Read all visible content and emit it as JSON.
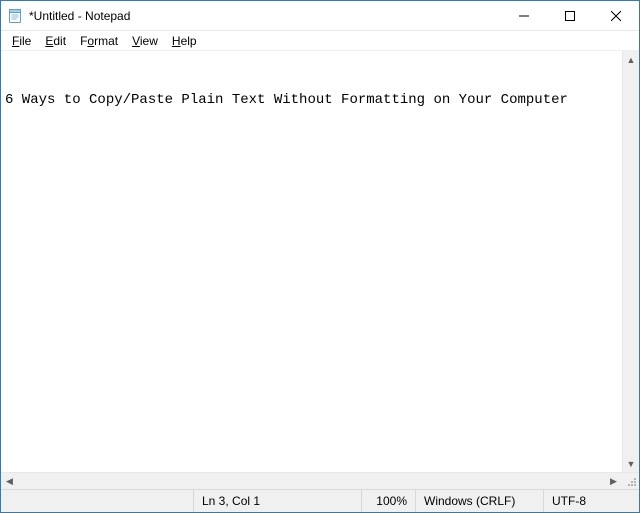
{
  "window": {
    "title": "*Untitled - Notepad"
  },
  "menu": {
    "file": "File",
    "edit": "Edit",
    "format": "Format",
    "view": "View",
    "help": "Help"
  },
  "editor": {
    "content": "\n\n6 Ways to Copy/Paste Plain Text Without Formatting on Your Computer"
  },
  "status": {
    "position": "Ln 3, Col 1",
    "zoom": "100%",
    "eol": "Windows (CRLF)",
    "encoding": "UTF-8"
  }
}
